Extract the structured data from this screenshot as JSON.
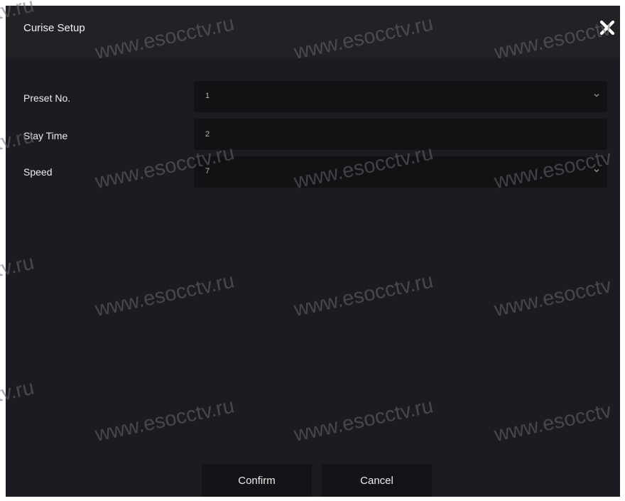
{
  "dialog": {
    "title": "Curise Setup",
    "close_icon": "close-icon"
  },
  "form": {
    "preset": {
      "label": "Preset No.",
      "value": "1",
      "icon": "chevron-down-icon"
    },
    "stay_time": {
      "label": "Stay Time",
      "value": "2"
    },
    "speed": {
      "label": "Speed",
      "value": "7",
      "icon": "chevron-down-icon"
    }
  },
  "buttons": {
    "confirm": "Confirm",
    "cancel": "Cancel"
  },
  "watermark": {
    "text": "www.esocctv.ru",
    "fragment_left": "tv.ru",
    "fragment_right": "www.esocctv"
  }
}
